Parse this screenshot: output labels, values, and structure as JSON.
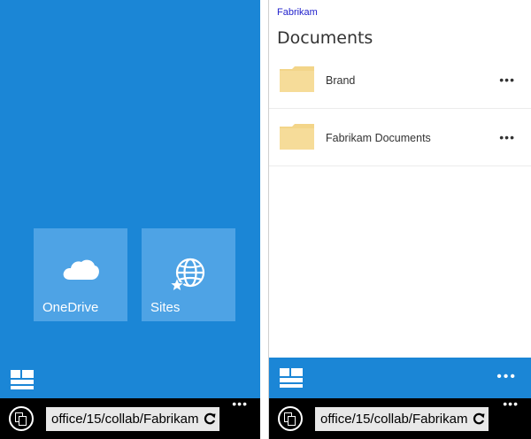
{
  "left_phone": {
    "tiles": [
      {
        "label": "OneDrive",
        "icon": "cloud-icon"
      },
      {
        "label": "Sites",
        "icon": "globe-star-icon"
      }
    ],
    "address_bar": {
      "url": "office/15/collab/Fabrikam",
      "more": "•••"
    }
  },
  "right_phone": {
    "site_link": "Fabrikam",
    "title": "Documents",
    "folders": [
      {
        "name": "Brand",
        "more": "•••"
      },
      {
        "name": "Fabrikam Documents",
        "more": "•••"
      }
    ],
    "app_bar_more": "•••",
    "address_bar": {
      "url": "office/15/collab/Fabrikam",
      "more": "•••"
    }
  },
  "colors": {
    "accent": "#1b86d6",
    "tile": "#4ea3e5",
    "folder": "#f3d589",
    "link": "#2222cc"
  }
}
